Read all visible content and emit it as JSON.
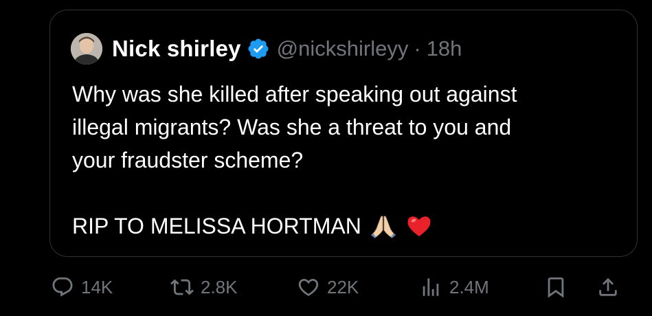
{
  "tweet": {
    "author": {
      "display_name": "Nick shirley",
      "handle": "@nickshirleyy",
      "verified": true,
      "avatar_icon": "profile-photo"
    },
    "separator": "·",
    "timestamp": "18h",
    "text_lines": [
      "Why was she killed after speaking out against",
      "illegal migrants? Was she a threat to you and",
      "your fraudster scheme?"
    ],
    "rip_text": "RIP TO MELISSA HORTMAN",
    "emojis": [
      "folded-hands-emoji",
      "red-heart-emoji"
    ]
  },
  "actions": {
    "replies": "14K",
    "reposts": "2.8K",
    "likes": "22K",
    "views": "2.4M"
  },
  "colors": {
    "background": "#000000",
    "text": "#ffffff",
    "muted": "#71767b",
    "border": "#2f3336",
    "verified": "#1d9bf0",
    "heart": "#e8212b"
  }
}
